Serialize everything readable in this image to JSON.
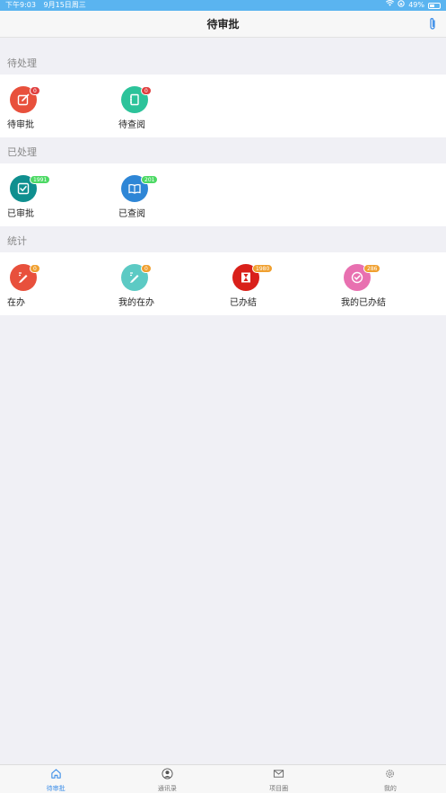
{
  "status_bar": {
    "time": "下午9:03",
    "date": "9月15日周三",
    "battery": "49%"
  },
  "header": {
    "title": "待审批"
  },
  "sections": [
    {
      "title": "待处理",
      "items": [
        {
          "label": "待审批",
          "badge": "0",
          "color": "#e8503c",
          "badge_color": "#e04040",
          "icon": "edit-icon"
        },
        {
          "label": "待查阅",
          "badge": "0",
          "color": "#2cc39a",
          "badge_color": "#e04040",
          "icon": "notebook-icon"
        }
      ]
    },
    {
      "title": "已处理",
      "items": [
        {
          "label": "已审批",
          "badge": "1991",
          "color": "#0f8f8f",
          "badge_color": "#4cd964",
          "icon": "checkbox-icon"
        },
        {
          "label": "已查阅",
          "badge": "201",
          "color": "#2e86d6",
          "badge_color": "#4cd964",
          "icon": "book-icon"
        }
      ]
    },
    {
      "title": "统计",
      "items": [
        {
          "label": "在办",
          "badge": "0",
          "color": "#e8503c",
          "badge_color": "#f0a030",
          "icon": "pencil-icon"
        },
        {
          "label": "我的在办",
          "badge": "0",
          "color": "#5ccac4",
          "badge_color": "#f0a030",
          "icon": "pencil-icon"
        },
        {
          "label": "已办结",
          "badge": "1980",
          "color": "#d9201a",
          "badge_color": "#f0a030",
          "icon": "hourglass-icon"
        },
        {
          "label": "我的已办结",
          "badge": "286",
          "color": "#e870b0",
          "badge_color": "#f0a030",
          "icon": "check-circle-icon"
        }
      ]
    }
  ],
  "tabs": [
    {
      "label": "待审批",
      "icon": "home-icon",
      "active": true
    },
    {
      "label": "通讯录",
      "icon": "contact-icon",
      "active": false
    },
    {
      "label": "项目圈",
      "icon": "mail-icon",
      "active": false
    },
    {
      "label": "我的",
      "icon": "gear-icon",
      "active": false
    }
  ]
}
